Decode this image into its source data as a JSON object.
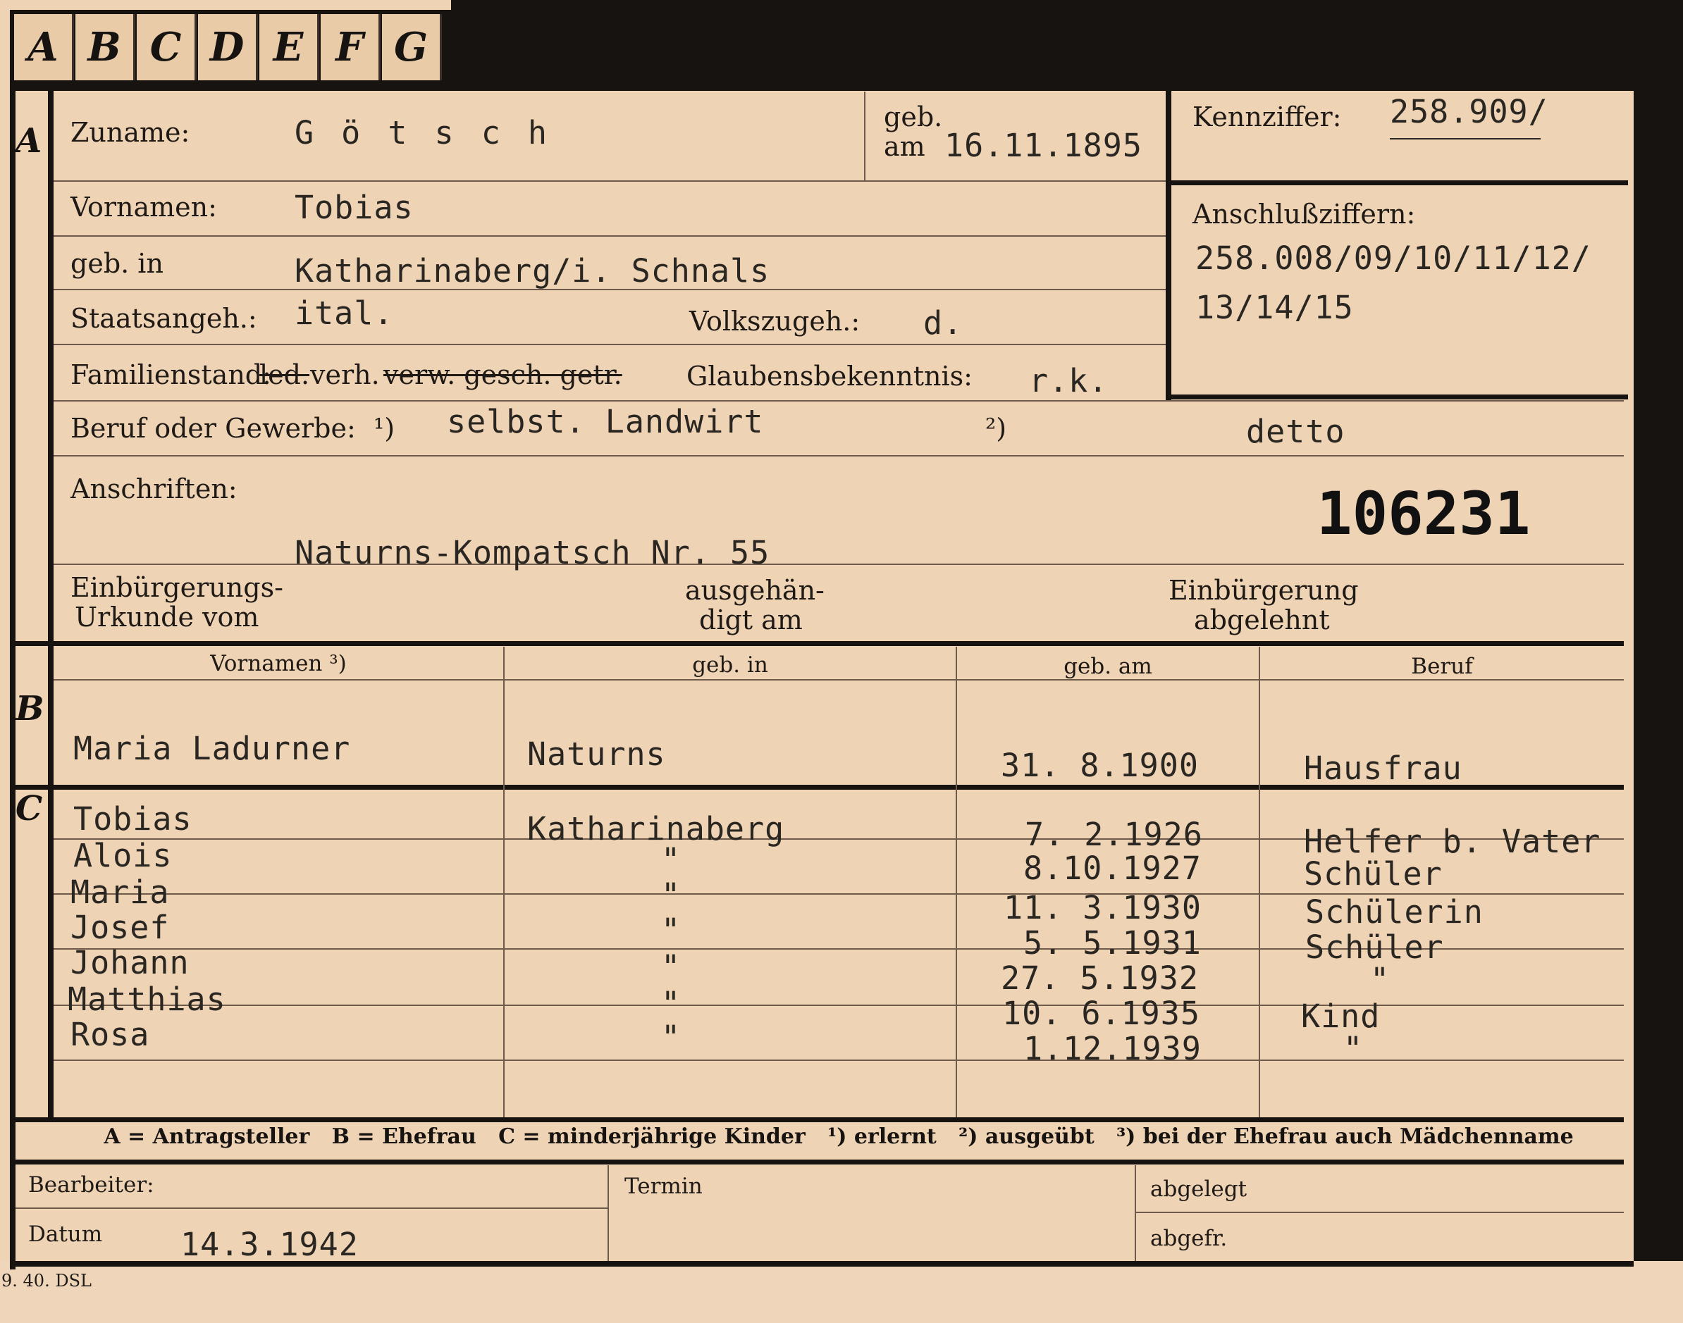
{
  "tabs": [
    "A",
    "B",
    "C",
    "D",
    "E",
    "F",
    "G"
  ],
  "sections": {
    "a": "A",
    "b": "B",
    "c": "C"
  },
  "header": {
    "surname_label": "Zuname:",
    "surname_value": "G ö t s c h",
    "geb_label": "geb.",
    "am_label": "am",
    "birth_date": "16.11.1895",
    "kennziffer_label": "Kennziffer:",
    "kennziffer_value": "258.909/",
    "anschluss_label": "Anschlußziffern:",
    "anschluss_line1": "258.008/09/10/11/12/",
    "anschluss_line2": "13/14/15"
  },
  "person": {
    "vornamen_label": "Vornamen:",
    "vornamen_value": "Tobias",
    "gebin_label": "geb. in",
    "gebin_value": "Katharinaberg/i. Schnals",
    "staat_label": "Staatsangeh.:",
    "staat_value": "ital.",
    "volks_label": "Volkszugeh.:",
    "volks_value": "d.",
    "familien_label": "Familienstand:",
    "fam_led": "led.",
    "fam_verh": "verh.",
    "fam_struck": "verw. gesch. getr.",
    "glaube_label": "Glaubensbekenntnis:",
    "glaube_value": "r.k.",
    "beruf_label": "Beruf oder Gewerbe:",
    "beruf_note1": "¹)",
    "beruf_value1": "selbst. Landwirt",
    "beruf_note2": "²)",
    "beruf_value2": "detto",
    "anschriften_label": "Anschriften:",
    "stamp_number": "106231",
    "address": "Naturns-Kompatsch Nr. 55",
    "einb_label1": "Einbürgerungs-",
    "einb_label2": "Urkunde vom",
    "ausg_label1": "ausgehän-",
    "ausg_label2": "digt am",
    "abgel_label1": "Einbürgerung",
    "abgel_label2": "abgelehnt"
  },
  "family_table": {
    "headers": [
      "Vornamen ³)",
      "geb. in",
      "geb. am",
      "Beruf"
    ],
    "spouse": [
      "Maria Ladurner",
      "Naturns",
      "31. 8.1900",
      "Hausfrau"
    ],
    "children": [
      [
        "Tobias",
        "Katharinaberg",
        "7. 2.1926",
        "Helfer b. Vater"
      ],
      [
        "Alois",
        "\"",
        "8.10.1927",
        "Schüler"
      ],
      [
        "Maria",
        "\"",
        "11. 3.1930",
        "Schülerin"
      ],
      [
        "Josef",
        "\"",
        "5. 5.1931",
        "Schüler"
      ],
      [
        "Johann",
        "\"",
        "27. 5.1932",
        "\""
      ],
      [
        "Matthias",
        "\"",
        "10. 6.1935",
        "Kind"
      ],
      [
        "Rosa",
        "\"",
        "1.12.1939",
        "\""
      ]
    ]
  },
  "legend": "A = Antragsteller   B = Ehefrau   C = minderjährige Kinder   ¹) erlernt   ²) ausgeübt   ³) bei der Ehefrau auch Mädchenname",
  "footer": {
    "bearbeiter_label": "Bearbeiter:",
    "datum_label": "Datum",
    "datum_value": "14.3.1942",
    "termin_label": "Termin",
    "abgelegt_label": "abgelegt",
    "abgefr_label": "abgefr.",
    "print_code": "9. 40. DSL"
  }
}
